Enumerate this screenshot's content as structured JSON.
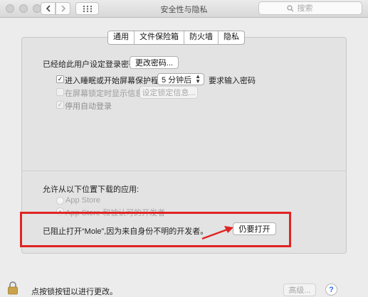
{
  "window": {
    "title": "安全性与隐私"
  },
  "toolbar": {
    "back_icon": "chevron-left-icon",
    "forward_icon": "chevron-right-icon",
    "grid_icon": "grid-icon",
    "search_placeholder": "搜索"
  },
  "tabs": [
    {
      "label": "通用",
      "active": true
    },
    {
      "label": "文件保险箱",
      "active": false
    },
    {
      "label": "防火墙",
      "active": false
    },
    {
      "label": "隐私",
      "active": false
    }
  ],
  "general": {
    "password_set_label": "已经给此用户设定登录密码",
    "change_password_button": "更改密码...",
    "require_password": {
      "checked": true,
      "label_prefix": "进入睡眠或开始屏幕保护程序",
      "delay_value": "5 分钟后",
      "label_suffix": "要求输入密码"
    },
    "show_message": {
      "checked": false,
      "label": "在屏幕锁定时显示信息",
      "button": "设定锁定信息..."
    },
    "disable_auto_login": {
      "checked": true,
      "label": "停用自动登录"
    }
  },
  "downloads": {
    "heading": "允许从以下位置下载的应用:",
    "options": [
      {
        "label": "App Store",
        "selected": false
      },
      {
        "label": "App Store 和被认可的开发者",
        "selected": true
      }
    ],
    "blocked_message": "已阻止打开“Mole”,因为来自身份不明的开发者。",
    "open_anyway_button": "仍要打开"
  },
  "footer": {
    "lock_text": "点按锁按钮以进行更改。",
    "advanced_button": "高级...",
    "help_label": "?"
  },
  "colors": {
    "highlight": "#e02424",
    "panel": "#e3e3e3",
    "window": "#ececec"
  }
}
